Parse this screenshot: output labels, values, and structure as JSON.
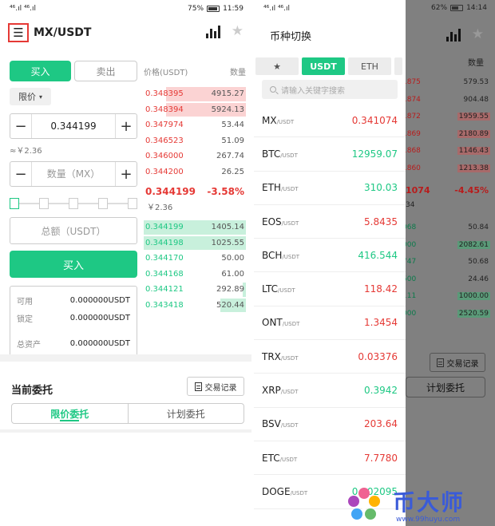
{
  "left": {
    "status": {
      "signal": "⁴⁶.ıl ⁴⁶.ıl",
      "battery": "75%",
      "time": "11:59"
    },
    "pair": "MX/USDT",
    "trade": {
      "buy_tab": "买入",
      "sell_tab": "卖出",
      "order_type": "限价",
      "price": "0.344199",
      "approx": "≈￥2.36",
      "qty_placeholder": "数量（MX）",
      "total_placeholder": "总额（USDT）",
      "buy_button": "买入",
      "slider_level": 0
    },
    "balances": [
      {
        "label": "可用",
        "value": "0.000000USDT"
      },
      {
        "label": "锁定",
        "value": "0.000000USDT"
      },
      {
        "label": "总资产",
        "value": "0.000000USDT"
      }
    ],
    "book": {
      "price_header": "价格(USDT)",
      "qty_header": "数量",
      "asks": [
        {
          "price": "0.348395",
          "qty": "4915.27",
          "depth": 0.78
        },
        {
          "price": "0.348394",
          "qty": "5924.13",
          "depth": 0.78
        },
        {
          "price": "0.347974",
          "qty": "53.44",
          "depth": 0
        },
        {
          "price": "0.346523",
          "qty": "51.09",
          "depth": 0
        },
        {
          "price": "0.346000",
          "qty": "267.74",
          "depth": 0
        },
        {
          "price": "0.344200",
          "qty": "26.25",
          "depth": 0
        }
      ],
      "last_price": "0.344199",
      "change": "-3.58%",
      "last_cny": "￥2.36",
      "bids": [
        {
          "price": "0.344199",
          "qty": "1405.14",
          "depth": 1.0
        },
        {
          "price": "0.344198",
          "qty": "1025.55",
          "depth": 1.0
        },
        {
          "price": "0.344170",
          "qty": "50.00",
          "depth": 0
        },
        {
          "price": "0.344168",
          "qty": "61.00",
          "depth": 0
        },
        {
          "price": "0.344121",
          "qty": "292.89",
          "depth": 0.03
        },
        {
          "price": "0.343418",
          "qty": "520.44",
          "depth": 0.25
        }
      ]
    },
    "orders": {
      "title": "当前委托",
      "history_button": "交易记录",
      "tab_limit": "限价委托",
      "tab_plan": "计划委托"
    }
  },
  "right": {
    "status": {
      "signal": "⁴⁶.ıl ⁴⁶.ıl",
      "battery": "62%",
      "time": "14:14"
    },
    "drawer": {
      "title": "币种切换",
      "tabs": [
        "★",
        "USDT",
        "ETH"
      ],
      "search_placeholder": "请输入关键字搜索",
      "coins": [
        {
          "name": "MX",
          "quote": "/USDT",
          "price": "0.341074",
          "dir": "down"
        },
        {
          "name": "BTC",
          "quote": "/USDT",
          "price": "12959.07",
          "dir": "up"
        },
        {
          "name": "ETH",
          "quote": "/USDT",
          "price": "310.03",
          "dir": "up"
        },
        {
          "name": "EOS",
          "quote": "/USDT",
          "price": "5.8435",
          "dir": "down"
        },
        {
          "name": "BCH",
          "quote": "/USDT",
          "price": "416.544",
          "dir": "up"
        },
        {
          "name": "LTC",
          "quote": "/USDT",
          "price": "118.42",
          "dir": "down"
        },
        {
          "name": "ONT",
          "quote": "/USDT",
          "price": "1.3454",
          "dir": "down"
        },
        {
          "name": "TRX",
          "quote": "/USDT",
          "price": "0.03376",
          "dir": "down"
        },
        {
          "name": "XRP",
          "quote": "/USDT",
          "price": "0.3942",
          "dir": "up"
        },
        {
          "name": "BSV",
          "quote": "/USDT",
          "price": "203.64",
          "dir": "down"
        },
        {
          "name": "ETC",
          "quote": "/USDT",
          "price": "7.7780",
          "dir": "down"
        },
        {
          "name": "DOGE",
          "quote": "/USDT",
          "price": "0.002095",
          "dir": "up"
        }
      ]
    },
    "behind": {
      "qty_header": "数量",
      "asks": [
        {
          "price": "1875",
          "qty": "579.53"
        },
        {
          "price": "1874",
          "qty": "904.48"
        },
        {
          "price": "1872",
          "qty": "1959.55"
        },
        {
          "price": "1869",
          "qty": "2180.89"
        },
        {
          "price": "1868",
          "qty": "1146.43"
        },
        {
          "price": "1860",
          "qty": "1213.38"
        }
      ],
      "last_price": "1074",
      "change": "-4.45%",
      "last_sub": "34",
      "bids": [
        {
          "price": "068",
          "qty": "50.84"
        },
        {
          "price": "000",
          "qty": "2082.61"
        },
        {
          "price": "747",
          "qty": "50.68"
        },
        {
          "price": "500",
          "qty": "24.46"
        },
        {
          "price": "111",
          "qty": "1000.00"
        },
        {
          "price": "000",
          "qty": "2520.59"
        }
      ],
      "history_button": "交易记录",
      "tab_plan": "计划委托"
    }
  },
  "watermark": {
    "brand": "币大师",
    "url": "www.99huyu.com"
  },
  "colors": {
    "green": "#1ec884",
    "red": "#e53935",
    "highlight_box": "#e53935"
  }
}
